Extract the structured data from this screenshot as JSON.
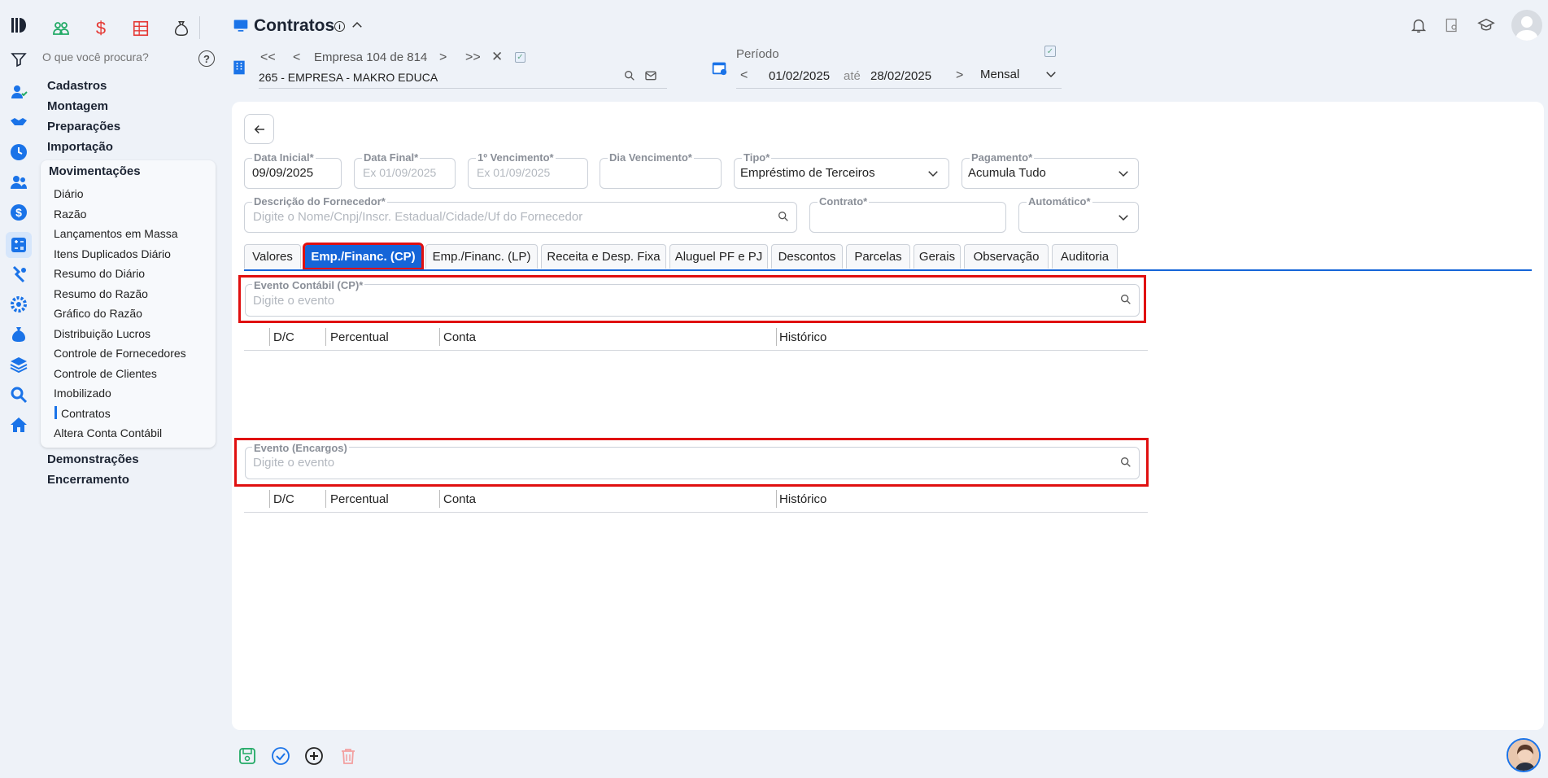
{
  "app": {
    "title": "Contratos"
  },
  "nav": {
    "search_placeholder": "O que você procura?",
    "sections": [
      "Cadastros",
      "Montagem",
      "Preparações",
      "Importação"
    ],
    "active_section": "Movimentações",
    "items": [
      "Diário",
      "Razão",
      "Lançamentos em Massa",
      "Itens Duplicados Diário",
      "Resumo do Diário",
      "Resumo do Razão",
      "Gráfico do Razão",
      "Distribuição Lucros",
      "Controle de Fornecedores",
      "Controle de Clientes",
      "Imobilizado",
      "Contratos",
      "Altera Conta Contábil"
    ],
    "active_item": "Contratos",
    "bottom_sections": [
      "Demonstrações",
      "Encerramento"
    ]
  },
  "company": {
    "nav_label": "Empresa 104 de 814",
    "name": "265 - EMPRESA - MAKRO EDUCA"
  },
  "period": {
    "label": "Período",
    "start": "01/02/2025",
    "sep": "até",
    "end": "28/02/2025",
    "mode": "Mensal"
  },
  "form": {
    "data_inicial": {
      "label": "Data Inicial*",
      "value": "09/09/2025"
    },
    "data_final": {
      "label": "Data Final*",
      "placeholder": "Ex 01/09/2025"
    },
    "primeiro_venc": {
      "label": "1º Vencimento*",
      "placeholder": "Ex 01/09/2025"
    },
    "dia_venc": {
      "label": "Dia Vencimento*",
      "value": ""
    },
    "tipo": {
      "label": "Tipo*",
      "value": "Empréstimo de Terceiros"
    },
    "pagamento": {
      "label": "Pagamento*",
      "value": "Acumula Tudo"
    },
    "fornecedor": {
      "label": "Descrição do Fornecedor*",
      "placeholder": "Digite o Nome/Cnpj/Inscr. Estadual/Cidade/Uf do Fornecedor"
    },
    "contrato": {
      "label": "Contrato*",
      "value": ""
    },
    "automatico": {
      "label": "Automático*",
      "value": ""
    }
  },
  "tabs": [
    "Valores",
    "Emp./Financ. (CP)",
    "Emp./Financ. (LP)",
    "Receita e Desp. Fixa",
    "Aluguel PF e PJ",
    "Descontos",
    "Parcelas",
    "Gerais",
    "Observação",
    "Auditoria"
  ],
  "active_tab": "Emp./Financ. (CP)",
  "evento_cp": {
    "label": "Evento Contábil (CP)*",
    "placeholder": "Digite o evento"
  },
  "evento_encargos": {
    "label": "Evento (Encargos)",
    "placeholder": "Digite o evento"
  },
  "table_headers": [
    "D/C",
    "Percentual",
    "Conta",
    "Histórico"
  ],
  "colors": {
    "accent": "#1565d8",
    "highlight": "#e01010",
    "background": "#eef2f8"
  }
}
